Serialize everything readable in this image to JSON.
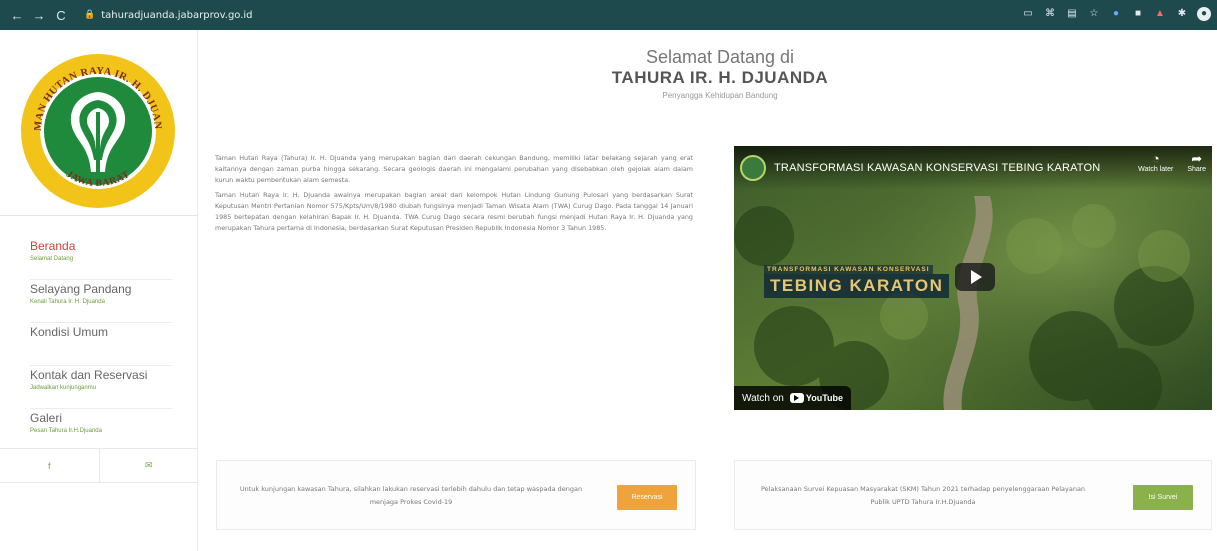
{
  "browser": {
    "back": "←",
    "forward": "→",
    "reload": "C",
    "url": "tahuradjuanda.jabarprov.go.id"
  },
  "logo": {
    "ring_text_top": "TAMAN HUTAN RAYA IR. H. DJUANDA",
    "ring_text_bottom": "JAWA BARAT",
    "colors": {
      "ring": "#f2c318",
      "inner": "#1f8a3c",
      "text": "#7a2f1d"
    }
  },
  "sidebar": {
    "items": [
      {
        "label": "Beranda",
        "sub": "Selamat Datang",
        "active": true
      },
      {
        "label": "Selayang Pandang",
        "sub": "Kenali Tahura Ir. H. Djuanda"
      },
      {
        "label": "Kondisi Umum",
        "sub": ""
      },
      {
        "label": "Kontak dan Reservasi",
        "sub": "Jadwalkan kunjunganmu"
      },
      {
        "label": "Galeri",
        "sub": "Pesan Tahura Ir.H.Djuanda"
      }
    ],
    "social": {
      "facebook": "f",
      "email": "✉"
    }
  },
  "header": {
    "line1": "Selamat Datang di",
    "line2": "TAHURA IR. H. DJUANDA",
    "line3": "Penyangga Kehidupan Bandung"
  },
  "article": {
    "p1": "Taman Hutan Raya (Tahura) Ir. H. Djuanda yang merupakan bagian dari daerah cekungan Bandung, memiliki latar belakang sejarah yang erat kaitannya dengan zaman purba hingga sekarang. Secara geologis daerah ini mengalami perubahan yang disebabkan oleh gejolak alam dalam kurun waktu pembentukan alam semesta.",
    "p2": "Taman Hutan Raya Ir. H. Djuanda awalnya merupakan bagian areal dari kelompok Hutan Lindung Gunung Pulosari yang berdasarkan Surat Keputusan Mentri Pertanian Nomor 575/Kpts/Um/8/1980 diubah fungsinya menjadi Taman Wisata Alam (TWA) Curug Dago. Pada tanggal 14 Januari 1985 bertepatan dengan kelahiran Bapak Ir. H. Djuanda. TWA Curug Dago secara resmi berubah fungsi menjadi Hutan Raya Ir. H. Djuanda yang merupakan Tahura pertama di Indonesia, berdasarkan Surat Keputusan Presiden Republik Indonesia Nomor 3 Tahun 1985."
  },
  "video": {
    "title": "TRANSFORMASI KAWASAN KONSERVASI TEBING KARATON",
    "watch_later": "Watch later",
    "share": "Share",
    "overlay_small": "TRANSFORMASI KAWASAN KONSERVASI",
    "overlay_big": "TEBING KARATON",
    "watch_on": "Watch on",
    "youtube": "YouTube"
  },
  "reservation_box": {
    "text": "Untuk kunjungan kawasan Tahura, silahkan lakukan reservasi terlebih dahulu dan tetap waspada dengan menjaga Prokes Covid-19",
    "button": "Reservasi",
    "button_color": "#efa33a"
  },
  "survey_box": {
    "text": "Pelaksanaan Survei Kepuasan Masyarakat (SKM) Tahun 2021 terhadap penyelenggaraan Pelayanan Publik UPTD Tahura Ir.H.Djuanda",
    "button": "Isi Survei",
    "button_color": "#8bb14a"
  }
}
